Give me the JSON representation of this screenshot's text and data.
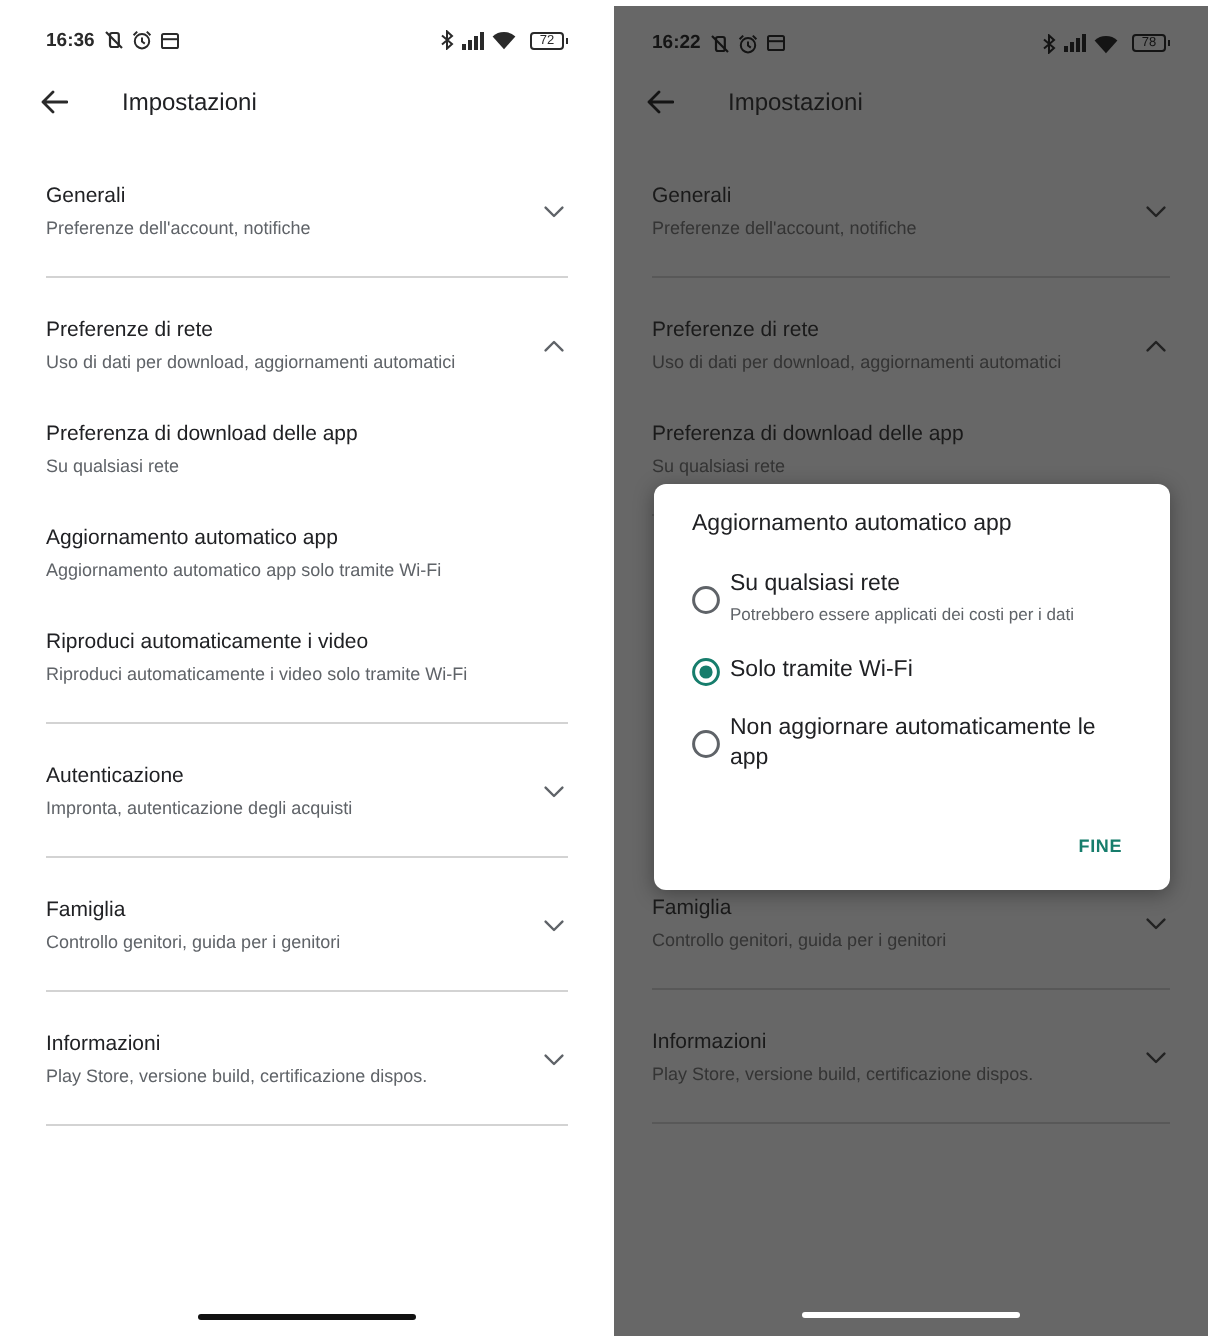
{
  "screens": [
    {
      "status_bar": {
        "time": "16:36",
        "battery": "72"
      },
      "app_bar": {
        "title": "Impostazioni"
      },
      "sections": [
        {
          "title": "Generali",
          "subtitle": "Preferenze dell'account, notifiche",
          "expanded": false
        },
        {
          "title": "Preferenze di rete",
          "subtitle": "Uso di dati per download, aggiornamenti automatici",
          "expanded": true,
          "children": [
            {
              "title": "Preferenza di download delle app",
              "subtitle": "Su qualsiasi rete"
            },
            {
              "title": "Aggiornamento automatico app",
              "subtitle": "Aggiornamento automatico app solo tramite Wi-Fi"
            },
            {
              "title": "Riproduci automaticamente i video",
              "subtitle": "Riproduci automaticamente i video solo tramite Wi-Fi"
            }
          ]
        },
        {
          "title": "Autenticazione",
          "subtitle": "Impronta, autenticazione degli acquisti",
          "expanded": false
        },
        {
          "title": "Famiglia",
          "subtitle": "Controllo genitori, guida per i genitori",
          "expanded": false
        },
        {
          "title": "Informazioni",
          "subtitle": "Play Store, versione build, certificazione dispos.",
          "expanded": false
        }
      ]
    },
    {
      "dimmed": true,
      "status_bar": {
        "time": "16:22",
        "battery": "78"
      },
      "app_bar": {
        "title": "Impostazioni"
      },
      "sections": [
        {
          "title": "Generali",
          "subtitle": "Preferenze dell'account, notifiche",
          "expanded": false
        },
        {
          "title": "Preferenze di rete",
          "subtitle": "Uso di dati per download, aggiornamenti automatici",
          "expanded": true,
          "children": [
            {
              "title": "Preferenza di download delle app",
              "subtitle": "Su qualsiasi rete"
            }
          ]
        }
      ],
      "dialog": {
        "title": "Aggiornamento automatico app",
        "options": [
          {
            "label": "Su qualsiasi rete",
            "description": "Potrebbero essere applicati dei costi per i dati",
            "selected": false
          },
          {
            "label": "Solo tramite Wi-Fi",
            "selected": true
          },
          {
            "label": "Non aggiornare automaticamente le app",
            "selected": false
          }
        ],
        "button": "FINE"
      },
      "sections_below_dialog": [
        {
          "title": "Famiglia",
          "subtitle": "Controllo genitori, guida per i genitori",
          "expanded": false
        },
        {
          "title": "Informazioni",
          "subtitle": "Play Store, versione build, certificazione dispos.",
          "expanded": false
        }
      ]
    }
  ]
}
